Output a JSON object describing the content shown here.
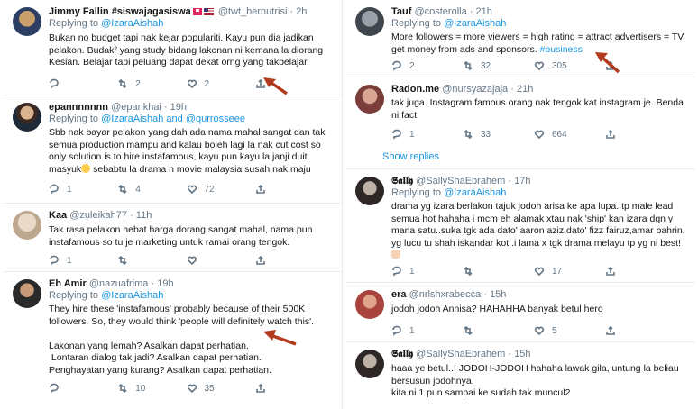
{
  "colors": {
    "link": "#1b95e0",
    "muted": "#657786",
    "text": "#14171a",
    "arrow": "#b23a1e"
  },
  "left": {
    "tweets": [
      {
        "name": "Jimmy Fallin #siswajagasiswa",
        "handle": "@twt_bernutrisi",
        "time": "· 2h",
        "reply_prefix": "Replying to ",
        "reply_to": "@IzaraAishah",
        "text": "Bukan no budget tapi nak kejar populariti. Kayu pun dia jadikan pelakon. Budak² yang study bidang lakonan ni kemana la diorang Kesian. Belajar tapi peluang dapat dekat orng yang takbelajar.",
        "replies": "",
        "retweets": "2",
        "likes": "2"
      },
      {
        "name": "epannnnnnn",
        "handle": "@epankhai",
        "time": "· 19h",
        "reply_prefix": "Replying to ",
        "reply_to": "@IzaraAishah and @qurrosseee",
        "text": "Sbb nak bayar pelakon yang dah ada nama mahal sangat dan tak semua production mampu and kalau boleh lagi la nak cut cost so only solution is to hire instafamous, kayu pun kayu la janji duit masyuk",
        "text2": " sebabtu la drama n movie malaysia susah nak maju",
        "replies": "1",
        "retweets": "4",
        "likes": "72"
      },
      {
        "name": "Kaa",
        "handle": "@zuleikah77",
        "time": "· 11h",
        "text": "Tak rasa pelakon hebat harga dorang sangat mahal, nama pun instafamous so tu je marketing untuk ramai orang tengok.",
        "replies": "1",
        "retweets": "",
        "likes": ""
      },
      {
        "name": "Eh Amir",
        "handle": "@nazuafrima",
        "time": "· 19h",
        "reply_prefix": "Replying to ",
        "reply_to": "@IzaraAishah",
        "text": "They hire these 'instafamous' probably because of their 500K followers. So, they would think 'people will definitely watch this'.\n\nLakonan yang lemah? Asalkan dapat perhatian.\n Lontaran dialog tak jadi? Asalkan dapat perhatian.\nPenghayatan yang kurang? Asalkan dapat perhatian.",
        "replies": "",
        "retweets": "10",
        "likes": "35"
      }
    ]
  },
  "right": {
    "tweets": [
      {
        "name": "Tauf",
        "handle": "@costerolla",
        "time": "· 21h",
        "reply_prefix": "Replying to ",
        "reply_to": "@IzaraAishah",
        "text": "More followers = more viewers = high rating = attract advertisers = TV get money from ads and sponsors. ",
        "hashtag": "#business",
        "replies": "2",
        "retweets": "32",
        "likes": "305"
      },
      {
        "name": "Radon.me",
        "handle": "@nursyazajaja",
        "time": "· 21h",
        "text": "tak juga. Instagram famous orang nak tengok kat instagram je. Benda ni fact",
        "replies": "1",
        "retweets": "33",
        "likes": "664"
      },
      {
        "show_replies": "Show replies"
      },
      {
        "name": "𝕾𝖆𝖑𝖑𝖞",
        "handle": "@SallyShaEbrahem",
        "time": "· 17h",
        "reply_prefix": "Replying to ",
        "reply_to": "@IzaraAishah",
        "text": "drama yg izara berlakon tajuk jodoh arisa ke apa lupa..tp male lead semua hot hahaha i mcm eh alamak xtau nak 'ship' kan izara dgn y mana satu..suka tgk ada dato' aaron aziz,dato' fizz fairuz,amar bahrin, yg lucu tu shah iskandar kot..i lama x tgk drama melayu tp yg ni best!",
        "replies": "1",
        "retweets": "",
        "likes": "17"
      },
      {
        "name": "era",
        "handle": "@nrlshxrabecca",
        "time": "· 15h",
        "text": "jodoh jodoh Annisa? HAHAHHA banyak betul hero",
        "replies": "1",
        "retweets": "",
        "likes": "5"
      },
      {
        "name": "𝕾𝖆𝖑𝖑𝖞",
        "handle": "@SallyShaEbrahem",
        "time": "· 15h",
        "text": "haaa ye betul..! JODOH-JODOH hahaha lawak gila, untung la beliau bersusun jodohnya,\nkita ni 1 pun sampai ke sudah tak muncul2",
        "replies": "",
        "retweets": "",
        "likes": ""
      }
    ]
  }
}
